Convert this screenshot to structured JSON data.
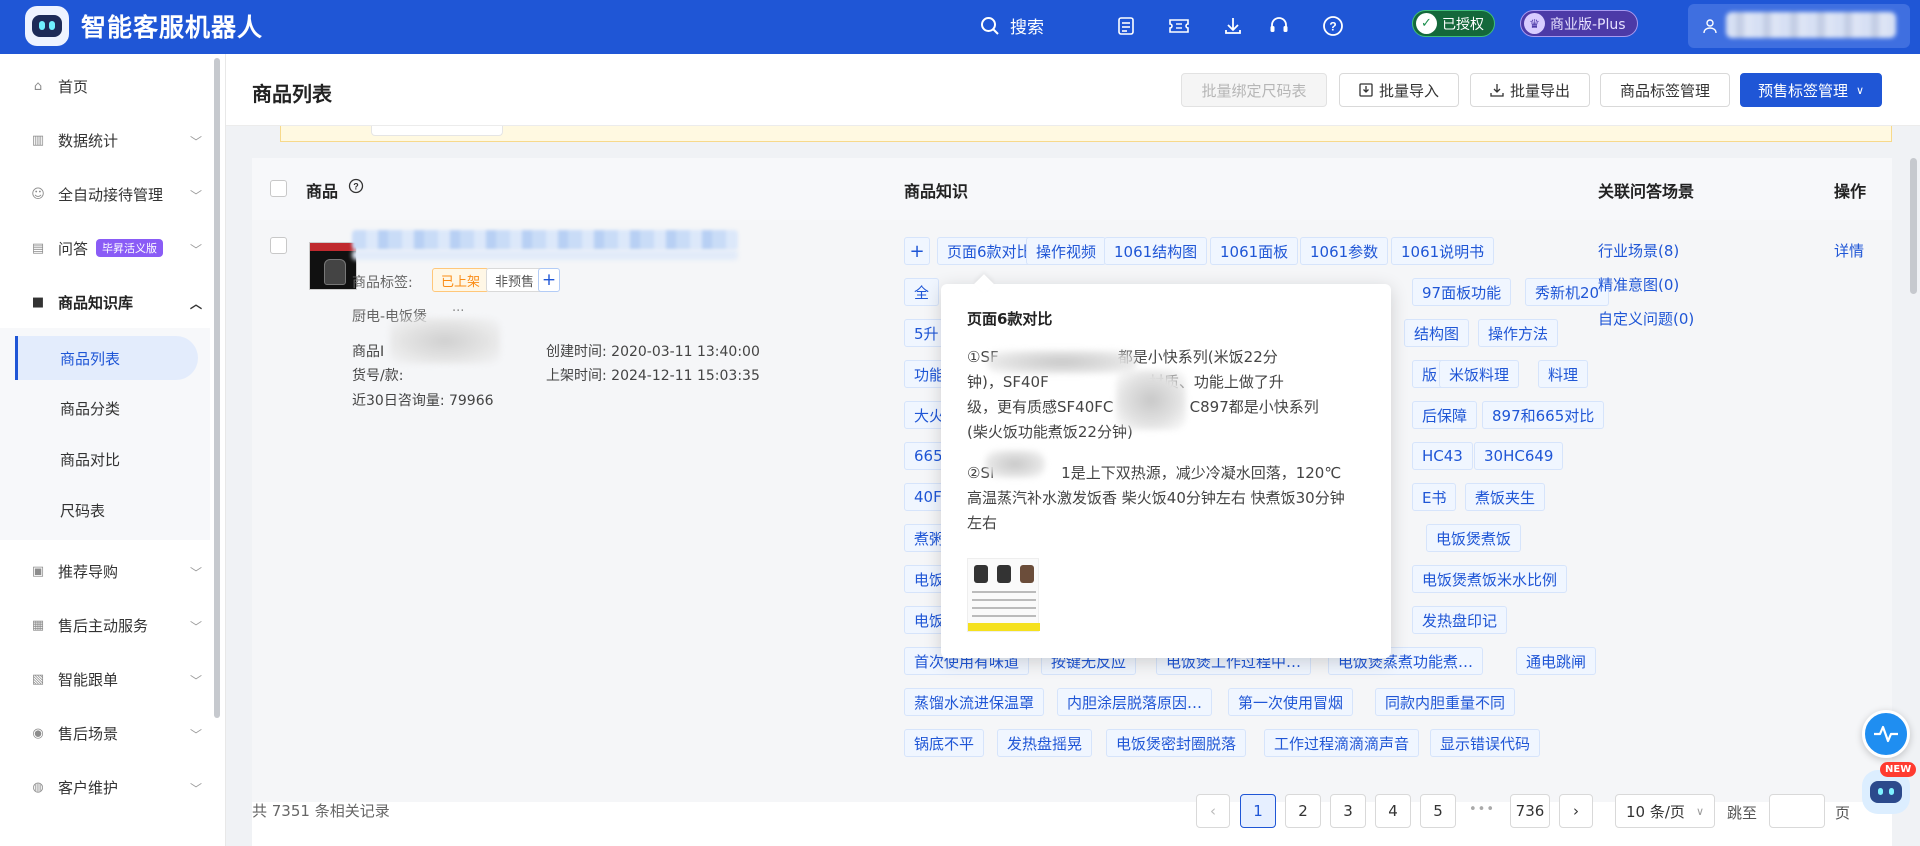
{
  "header": {
    "app_title": "智能客服机器人",
    "search_label": "搜索",
    "authorized_badge": "已授权",
    "plan_badge": "商业版-Plus",
    "icons": [
      "task-list-icon",
      "ticket-icon",
      "download-icon",
      "headset-icon",
      "help-icon"
    ]
  },
  "sidebar": {
    "items": [
      {
        "label": "首页",
        "icon": "home-icon"
      },
      {
        "label": "数据统计",
        "icon": "chart-icon"
      },
      {
        "label": "全自动接待管理",
        "icon": "robot-icon"
      },
      {
        "label": "问答",
        "icon": "qa-icon",
        "badge": "毕昇活义版"
      },
      {
        "label": "商品知识库",
        "icon": "bag-icon"
      },
      {
        "label": "推荐导购",
        "icon": "recommend-icon"
      },
      {
        "label": "售后主动服务",
        "icon": "service-icon"
      },
      {
        "label": "智能跟单",
        "icon": "follow-icon"
      },
      {
        "label": "售后场景",
        "icon": "scene-icon"
      },
      {
        "label": "客户维护",
        "icon": "customer-icon"
      }
    ],
    "sub_items": [
      {
        "label": "商品列表",
        "active": true
      },
      {
        "label": "商品分类",
        "active": false
      },
      {
        "label": "商品对比",
        "active": false
      },
      {
        "label": "尺码表",
        "active": false
      }
    ]
  },
  "page": {
    "title": "商品列表",
    "toolbar": {
      "batch_bind_size": "批量绑定尺码表",
      "batch_import": "批量导入",
      "batch_export": "批量导出",
      "tag_manage": "商品标签管理",
      "presale_tag_manage": "预售标签管理"
    }
  },
  "table": {
    "columns": {
      "product": "商品",
      "knowledge": "商品知识",
      "scenes": "关联问答场景",
      "actions": "操作"
    },
    "row": {
      "tags_label": "商品标签:",
      "tag_onshelf": "已上架",
      "tag_presale": "非预售",
      "category": "厨电-电饭煲",
      "more": "···",
      "id_label": "商品I",
      "sku_label": "货号/款:",
      "created": "创建时间: 2020-03-11 13:40:00",
      "listed": "上架时间: 2024-12-11 15:03:35",
      "consults": "近30日咨询量: 79966",
      "knowledge_chips": [
        "页面6款对比",
        "操作视频",
        "1061结构图",
        "1061面板",
        "1061参数",
        "1061说明书",
        "全",
        "97面板功能",
        "秀新机20",
        "5升",
        "结构图",
        "操作方法",
        "功能",
        "版",
        "米饭料理",
        "料理",
        "大火",
        "后保障",
        "897和665对比",
        "665",
        "HC43",
        "30HC649",
        "40F",
        "E书",
        "煮饭夹生",
        "煮粥",
        "电饭煲煮饭",
        "电饭",
        "电饭煲煮饭米水比例",
        "电饭",
        "发热盘印记",
        "首次使用有味道",
        "按键无反应",
        "电饭煲工作过程中…",
        "电饭煲蒸煮功能煮…",
        "通电跳闸",
        "蒸馏水流进保温罩",
        "内胆涂层脱落原因…",
        "第一次使用冒烟",
        "同款内胆重量不同",
        "锅底不平",
        "发热盘摇晃",
        "电饭煲密封圈脱落",
        "工作过程滴滴滴声音",
        "显示错误代码"
      ],
      "scene_links": [
        "行业场景(8)",
        "精准意图(0)",
        "自定义问题(0)"
      ],
      "action_detail": "详情"
    }
  },
  "popover": {
    "title": "页面6款对比",
    "para1": "①SF                         都是小快系列(米饭22分\n钟)，SF40F                     材质、功能上做了升\n级，更有质感SF40FC                C897都是小快系列\n(柴火饭功能煮饭22分钟)",
    "para2": "②SI              1是上下双热源，减少冷凝水回落，120℃\n高温蒸汽补水激发饭香 柴火饭40分钟左右 快煮饭30分钟\n左右"
  },
  "pagination": {
    "total": "共 7351 条相关记录",
    "pages": [
      "1",
      "2",
      "3",
      "4",
      "5"
    ],
    "ellipsis": "•••",
    "last_page": "736",
    "page_size": "10 条/页",
    "jump_label": "跳至",
    "page_unit": "页",
    "current": 1
  },
  "floating": {
    "new_badge": "NEW"
  },
  "colors": {
    "brand": "#1f56d6",
    "accent_orange": "#fa8c16"
  }
}
